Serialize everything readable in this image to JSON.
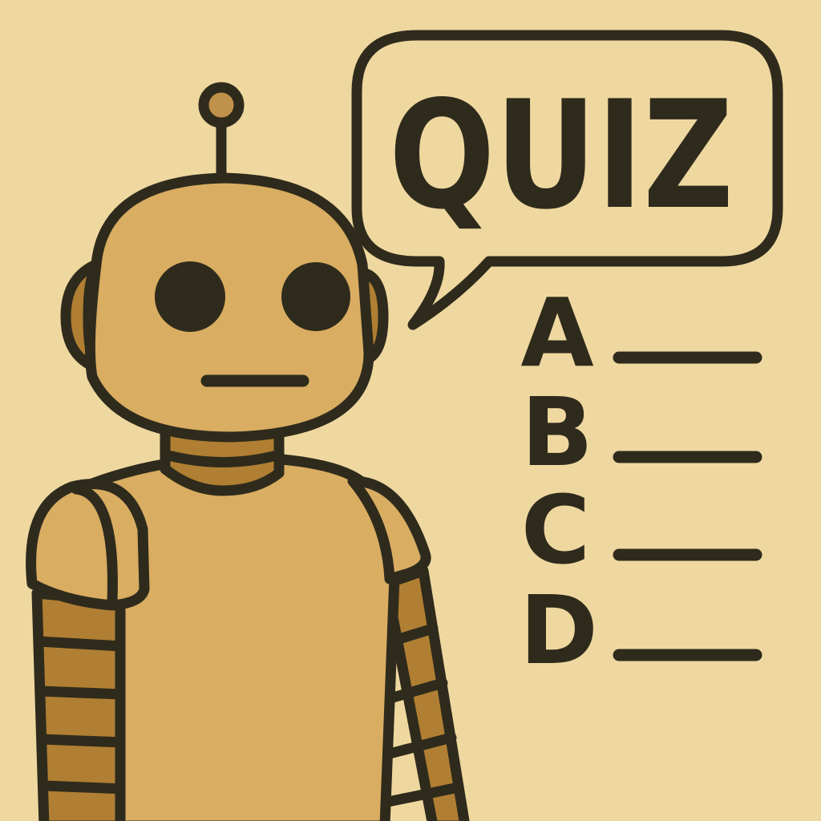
{
  "bubble": {
    "text": "QUIZ"
  },
  "options": [
    {
      "letter": "A"
    },
    {
      "letter": "B"
    },
    {
      "letter": "C"
    },
    {
      "letter": "D"
    }
  ],
  "colors": {
    "background": "#efd8a0",
    "robot_body": "#d9ad62",
    "robot_dark": "#b07f33",
    "outline": "#2f2b1c"
  }
}
